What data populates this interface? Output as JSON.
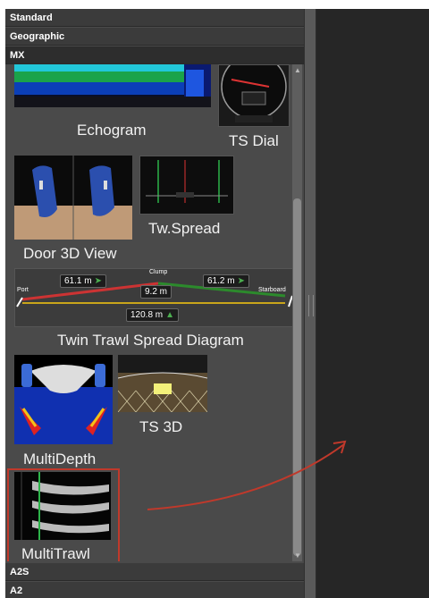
{
  "sections": {
    "standard": "Standard",
    "geographic": "Geographic",
    "mx": "MX",
    "a2s": "A2S",
    "a2": "A2"
  },
  "widgets": {
    "echogram": "Echogram",
    "ts_dial": "TS Dial",
    "door_3d": "Door 3D View",
    "tw_spread": "Tw.Spread",
    "twin_trawl": "Twin Trawl Spread Diagram",
    "multidepth": "MultiDepth",
    "ts_3d": "TS 3D",
    "multitrawl": "MultiTrawl"
  },
  "spread_diagram": {
    "port": "Port",
    "starboard": "Starboard",
    "clump": "Clump",
    "port_distance": "61.1 m",
    "starboard_distance": "61.2 m",
    "clump_distance": "9.2 m",
    "total_spread": "120.8 m"
  },
  "colors": {
    "selection": "#c0392b",
    "arrow": "#c0392b",
    "panel": "#4a4a4a"
  }
}
